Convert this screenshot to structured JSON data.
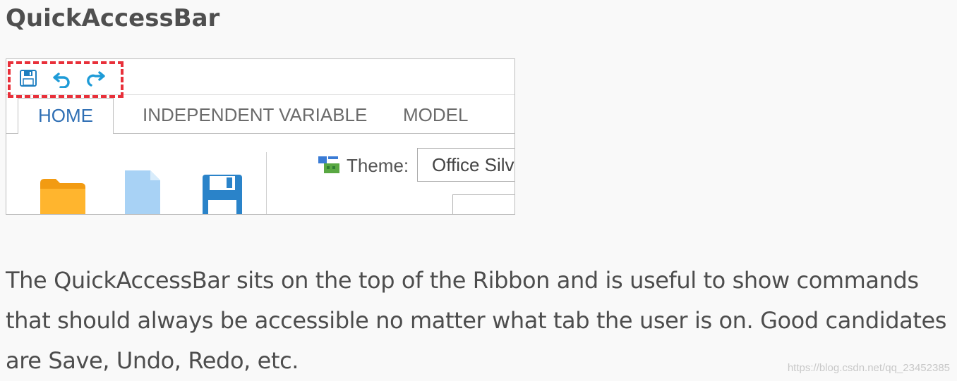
{
  "heading": "QuickAccessBar",
  "screenshot": {
    "quick_access": {
      "items": [
        {
          "icon": "save-icon"
        },
        {
          "icon": "undo-icon"
        },
        {
          "icon": "redo-icon"
        }
      ],
      "highlight_color": "#e8303a",
      "icon_color": "#1e9bd7"
    },
    "tabs": [
      {
        "label": "HOME",
        "selected": true
      },
      {
        "label": "INDEPENDENT VARIABLE",
        "selected": false
      },
      {
        "label": "MODEL",
        "selected": false
      }
    ],
    "theme_label": "Theme:",
    "theme_value": "Office Silver",
    "large_icons": [
      "folder-icon",
      "file-icon",
      "floppy-disk-icon"
    ]
  },
  "paragraph": "The QuickAccessBar sits on the top of the Ribbon and is useful to show commands that should always be accessible no matter what tab the user is on. Good candidates are Save, Undo, Redo, etc.",
  "watermark": "https://blog.csdn.net/qq_23452385"
}
